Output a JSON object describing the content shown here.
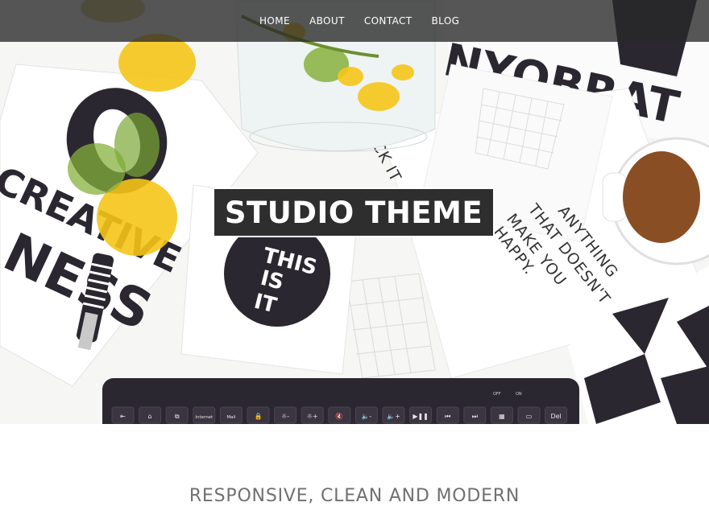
{
  "nav": {
    "items": [
      {
        "label": "HOME"
      },
      {
        "label": "ABOUT"
      },
      {
        "label": "CONTACT"
      },
      {
        "label": "BLOG"
      }
    ]
  },
  "hero": {
    "site_title": "STUDIO THEME",
    "scene_text": {
      "notebook_letter": "O",
      "creative": "CREATIVE",
      "ness": "NESS",
      "yobrat": "NYOBRAT",
      "note_line1": "ANYTHING",
      "note_line2": "THAT DOESN'T",
      "note_line3": "MAKE YOU",
      "note_line4": "HAPPY.",
      "diagonal": "CK IT",
      "circle_line1": "THIS",
      "circle_line2": "IS",
      "circle_line3": "IT"
    },
    "keyboard_keys": [
      "⇤",
      "⌂",
      "⧉",
      "Internet",
      "Mail",
      "🔒",
      "☼-",
      "☼+",
      "🔇",
      "🔈-",
      "🔈+",
      "▶❚❚",
      "⏮",
      "⏭",
      "▦",
      "▭",
      "Del"
    ],
    "keyboard_top_labels": [
      "OFF",
      "ON"
    ]
  },
  "tagline": "RESPONSIVE, CLEAN AND MODERN",
  "colors": {
    "nav_bg": "#282828",
    "title_box": "#2e2e2e",
    "tagline": "#707070",
    "flower": "#f5c518",
    "coffee": "#8a4e24",
    "ink": "#2b2730"
  }
}
